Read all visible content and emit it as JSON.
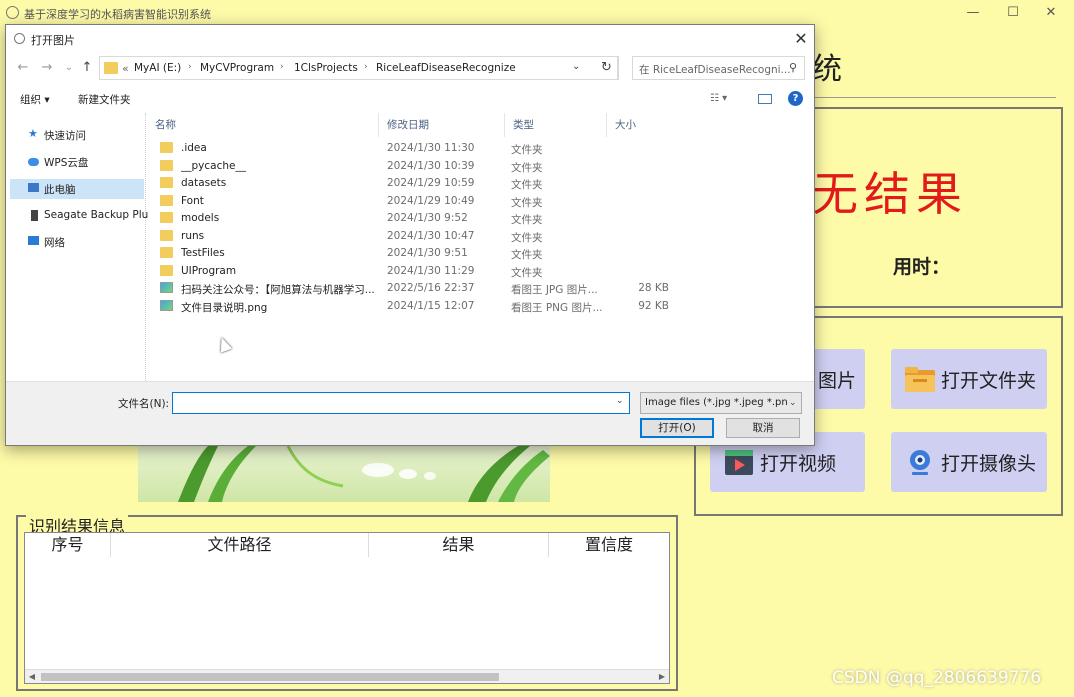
{
  "app": {
    "title": "基于深度学习的水稻病害智能识别系统",
    "heading_tail": "统",
    "result_text": "无结果",
    "time_label": "用时：",
    "buttons": [
      {
        "label": "打开图片",
        "visible_text": "图片"
      },
      {
        "label": "打开文件夹"
      },
      {
        "label": "打开视频"
      },
      {
        "label": "打开摄像头"
      }
    ],
    "info": {
      "legend": "识别结果信息",
      "columns": [
        "序号",
        "文件路径",
        "结果",
        "置信度"
      ]
    },
    "watermark": "CSDN @qq_2806639776"
  },
  "dialog": {
    "title": "打开图片",
    "close": "✕",
    "nav": {
      "back": "←",
      "forward": "→",
      "recent": "⌄",
      "up": "↑"
    },
    "address": {
      "prefix": "«",
      "segments": [
        "MyAI (E:)",
        "MyCVProgram",
        "1ClsProjects",
        "RiceLeafDiseaseRecognize"
      ],
      "separator": "›"
    },
    "refresh": "↻",
    "search_placeholder": "在 RiceLeafDiseaseRecogni...",
    "toolbar": {
      "organize": "组织 ▾",
      "new_folder": "新建文件夹"
    },
    "sidebar": [
      {
        "label": "快速访问",
        "icon": "star-icon",
        "color": "#2b7bd6"
      },
      {
        "label": "WPS云盘",
        "icon": "cloud-icon",
        "color": "#3a8ee6"
      },
      {
        "label": "此电脑",
        "icon": "computer-icon",
        "color": "#3b78c8"
      },
      {
        "label": "Seagate Backup Plu",
        "icon": "drive-icon",
        "color": "#444444"
      },
      {
        "label": "网络",
        "icon": "network-icon",
        "color": "#2b7bd6"
      }
    ],
    "columns": {
      "name": "名称",
      "date": "修改日期",
      "type": "类型",
      "size": "大小"
    },
    "files": [
      {
        "name": ".idea",
        "date": "2024/1/30 11:30",
        "type": "文件夹",
        "size": "",
        "kind": "folder"
      },
      {
        "name": "__pycache__",
        "date": "2024/1/30 10:39",
        "type": "文件夹",
        "size": "",
        "kind": "folder"
      },
      {
        "name": "datasets",
        "date": "2024/1/29 10:59",
        "type": "文件夹",
        "size": "",
        "kind": "folder"
      },
      {
        "name": "Font",
        "date": "2024/1/29 10:49",
        "type": "文件夹",
        "size": "",
        "kind": "folder"
      },
      {
        "name": "models",
        "date": "2024/1/30 9:52",
        "type": "文件夹",
        "size": "",
        "kind": "folder"
      },
      {
        "name": "runs",
        "date": "2024/1/30 10:47",
        "type": "文件夹",
        "size": "",
        "kind": "folder"
      },
      {
        "name": "TestFiles",
        "date": "2024/1/30 9:51",
        "type": "文件夹",
        "size": "",
        "kind": "folder"
      },
      {
        "name": "UIProgram",
        "date": "2024/1/30 11:29",
        "type": "文件夹",
        "size": "",
        "kind": "folder"
      },
      {
        "name": "扫码关注公众号：【阿旭算法与机器学习...",
        "date": "2022/5/16 22:37",
        "type": "看图王 JPG 图片...",
        "size": "28 KB",
        "kind": "img"
      },
      {
        "name": "文件目录说明.png",
        "date": "2024/1/15 12:07",
        "type": "看图王 PNG 图片...",
        "size": "92 KB",
        "kind": "img"
      }
    ],
    "filename_label": "文件名(N):",
    "filename_value": "",
    "filter": "Image files (*.jpg *.jpeg *.pn",
    "open_button": "打开(O)",
    "cancel_button": "取消"
  }
}
